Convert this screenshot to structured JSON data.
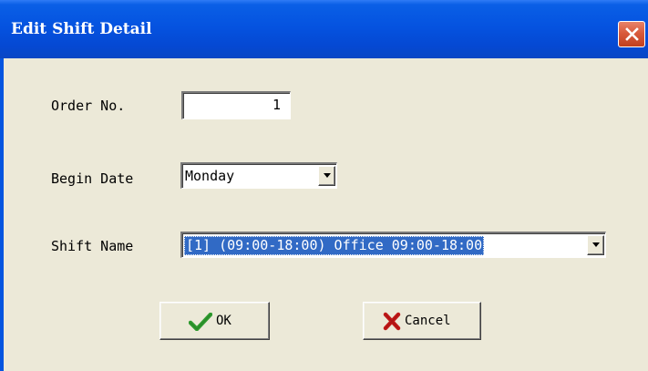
{
  "window": {
    "title": "Edit Shift Detail"
  },
  "form": {
    "order_no": {
      "label": "Order No.",
      "value": "1"
    },
    "begin_date": {
      "label": "Begin Date",
      "value": "Monday"
    },
    "shift_name": {
      "label": "Shift Name",
      "value": "[1] (09:00-18:00) Office 09:00-18:00"
    }
  },
  "buttons": {
    "ok": {
      "label": "OK",
      "icon": "checkmark-icon",
      "icon_color": "#2e9a2e"
    },
    "cancel": {
      "label": "Cancel",
      "icon": "cross-icon",
      "icon_color": "#c01818"
    }
  },
  "colors": {
    "titlebar": "#0553e0",
    "close_button": "#d95b3c",
    "selection": "#316ac5",
    "dialog_background": "#ece9d8"
  }
}
